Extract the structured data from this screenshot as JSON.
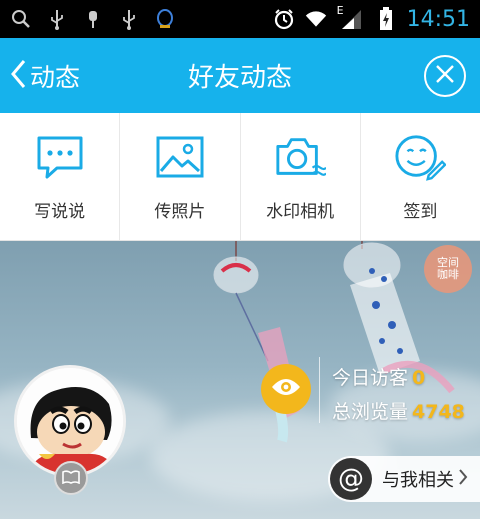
{
  "status_bar": {
    "time": "14:51",
    "network_label": "E",
    "icons": [
      "search-icon",
      "usb-icon",
      "usb-debug-icon",
      "usb-icon",
      "qq-icon",
      "alarm-icon",
      "wifi-icon",
      "signal-icon",
      "battery-charging-icon"
    ]
  },
  "title_bar": {
    "back_label": "动态",
    "title": "好友动态",
    "close_icon": "close-circle-icon",
    "background": "#16b2ec"
  },
  "actions": [
    {
      "label": "写说说",
      "icon": "chat-bubble-icon"
    },
    {
      "label": "传照片",
      "icon": "image-icon"
    },
    {
      "label": "水印相机",
      "icon": "camera-icon"
    },
    {
      "label": "签到",
      "icon": "smiley-pen-icon"
    }
  ],
  "cover": {
    "stamp_text": "空间 咖啡",
    "stats": {
      "today_label": "今日访客",
      "today_value": "0",
      "total_label": "总浏览量",
      "total_value": "4748"
    },
    "related_label": "与我相关",
    "accent": "#f3b71c"
  }
}
